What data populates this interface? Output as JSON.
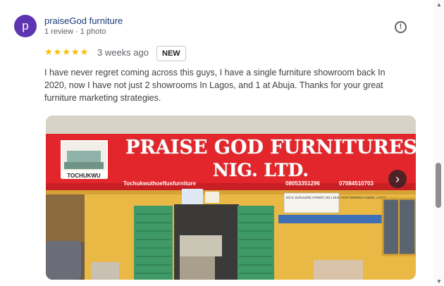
{
  "reviewer": {
    "initial": "p",
    "name": "praiseGod furniture",
    "meta": "1 review · 1 photo",
    "avatar_color": "#5e35b1"
  },
  "review": {
    "rating": 5,
    "stars": "★★★★★",
    "time": "3 weeks ago",
    "badge": "NEW",
    "text": "I have never regret coming across this guys, I have a single furniture showroom back In 2020, now I have not just 2 showrooms In Lagos, and 1 at Abuja. Thanks for your great furniture marketing strategies."
  },
  "photo": {
    "sign_line1": "PRAISE GOD FURNITURES",
    "sign_line2": "NIG. LTD.",
    "logo_label": "TOCHUKWU",
    "social": "Tochukwuthoeflusfurniture",
    "phone1": "08053351296",
    "phone2": "07084510703",
    "address": "NO 5, SURULERE STREET, NO 1 BUS STOP DOPEMU AGEGE, LAGOS."
  },
  "icons": {
    "report": "report-flag-icon",
    "next": "chevron-right-icon"
  },
  "colors": {
    "star": "#fbbc04",
    "sign_red": "#e3262b",
    "door_green": "#3f9a67"
  }
}
